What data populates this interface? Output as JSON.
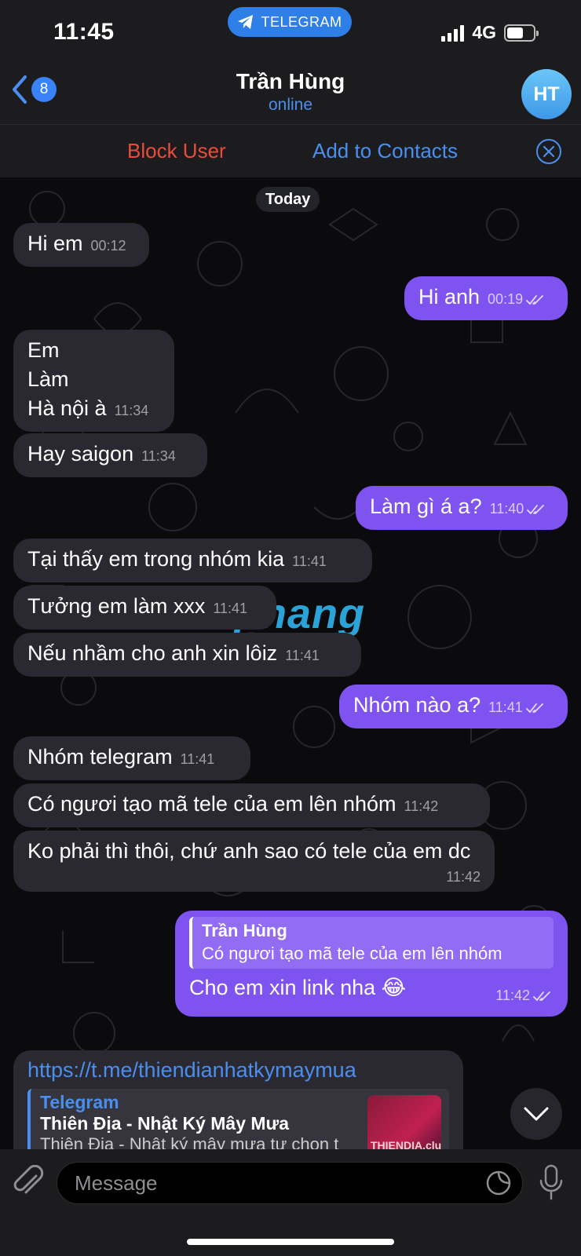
{
  "status_bar": {
    "time": "11:45",
    "pill": "TELEGRAM",
    "network": "4G"
  },
  "header": {
    "back_count": "8",
    "title": "Trần Hùng",
    "subtitle": "online",
    "avatar_initials": "HT",
    "block_label": "Block User",
    "add_label": "Add to Contacts"
  },
  "chat": {
    "date": "Today",
    "messages": [
      {
        "dir": "in",
        "text": "Hi em",
        "time": "00:12"
      },
      {
        "dir": "out",
        "text": "Hi anh",
        "time": "00:19"
      },
      {
        "dir": "in",
        "text": "Em\nLàm\nHà nội à",
        "time": "11:34"
      },
      {
        "dir": "in",
        "text": "Hay saigon",
        "time": "11:34"
      },
      {
        "dir": "out",
        "text": "Làm gì á a?",
        "time": "11:40"
      },
      {
        "dir": "in",
        "text": "Tại thấy em trong nhóm kia",
        "time": "11:41"
      },
      {
        "dir": "in",
        "text": "Tưởng em làm xxx",
        "time": "11:41"
      },
      {
        "dir": "in",
        "text": "Nếu nhầm cho anh xin lôiz",
        "time": "11:41"
      },
      {
        "dir": "out",
        "text": "Nhóm nào a?",
        "time": "11:41"
      },
      {
        "dir": "in",
        "text": "Nhóm telegram",
        "time": "11:41"
      },
      {
        "dir": "in",
        "text": "Có ngươi tạo mã tele của em lên nhóm",
        "time": "11:42"
      },
      {
        "dir": "in",
        "text": "Ko phải thì thôi, chứ anh sao có tele của em dc",
        "time": "11:42"
      },
      {
        "dir": "out",
        "reply_name": "Trần Hùng",
        "reply_text": "Có ngươi tạo mã tele của em lên nhóm",
        "text": "Cho em xin link nha 😂",
        "time": "11:42"
      }
    ],
    "link_message": {
      "url": "https://t.me/thiendianhatkymaymua",
      "site": "Telegram",
      "title": "Thiên Địa - Nhật Ký Mây Mưa",
      "desc": "Thiên Địa - Nhật ký mây mưa tự chọn t",
      "thumb_text": "THIENDIA.club"
    },
    "watermark": {
      "a": "A",
      "rest": "phang"
    }
  },
  "input": {
    "placeholder": "Message"
  },
  "colors": {
    "accent": "#4a8ff0",
    "outgoing": "#7f53f0",
    "danger": "#eb4b3c"
  },
  "icons": [
    "telegram-icon",
    "back-chevron-icon",
    "close-circle-icon",
    "double-check-icon",
    "chevron-down-icon",
    "paperclip-icon",
    "sticker-icon",
    "microphone-icon"
  ]
}
